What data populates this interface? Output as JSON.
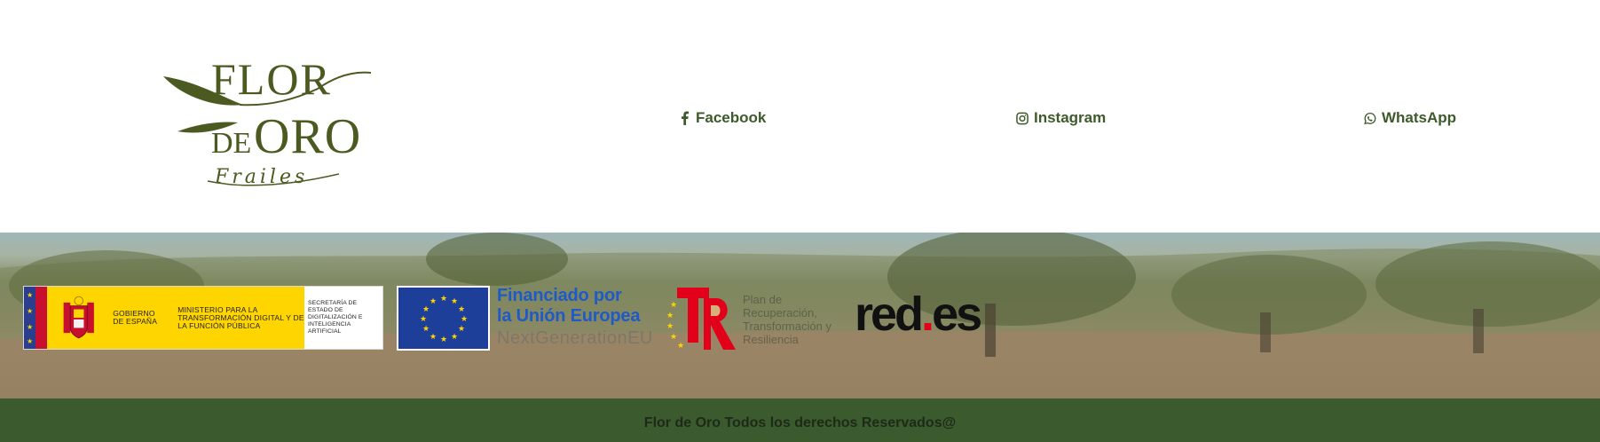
{
  "brand": {
    "logo_alt": "Flor de Oro Frailes",
    "logo_lines": [
      "FLOR",
      "DE",
      "ORO",
      "Frailes"
    ],
    "color": "#4b5a20"
  },
  "social": [
    {
      "label": "Facebook",
      "icon": "facebook-icon"
    },
    {
      "label": "Instagram",
      "icon": "instagram-icon"
    },
    {
      "label": "WhatsApp",
      "icon": "whatsapp-icon"
    }
  ],
  "funding": {
    "gov": {
      "gobierno": "GOBIERNO DE ESPAÑA",
      "ministerio": "MINISTERIO PARA LA TRANSFORMACIÓN DIGITAL Y DE LA FUNCIÓN PÚBLICA",
      "secretaria": "SECRETARÍA DE ESTADO DE DIGITALIZACIÓN E INTELIGENCIA ARTIFICIAL"
    },
    "eu": {
      "line1": "Financiado por",
      "line2": "la Unión Europea",
      "line3": "NextGenerationEU"
    },
    "prtr": {
      "text": "Plan de Recuperación, Transformación y Resiliencia"
    },
    "redes": {
      "prefix": "red",
      "dot": ".",
      "suffix": "es"
    }
  },
  "footer": {
    "text": "Flor de Oro Todos los derechos Reservados@"
  },
  "colors": {
    "accent": "#3c5a2a",
    "footer_bg": "#3b5a2e",
    "eu_blue": "#1d3f9a",
    "gov_yellow": "#ffd500"
  }
}
